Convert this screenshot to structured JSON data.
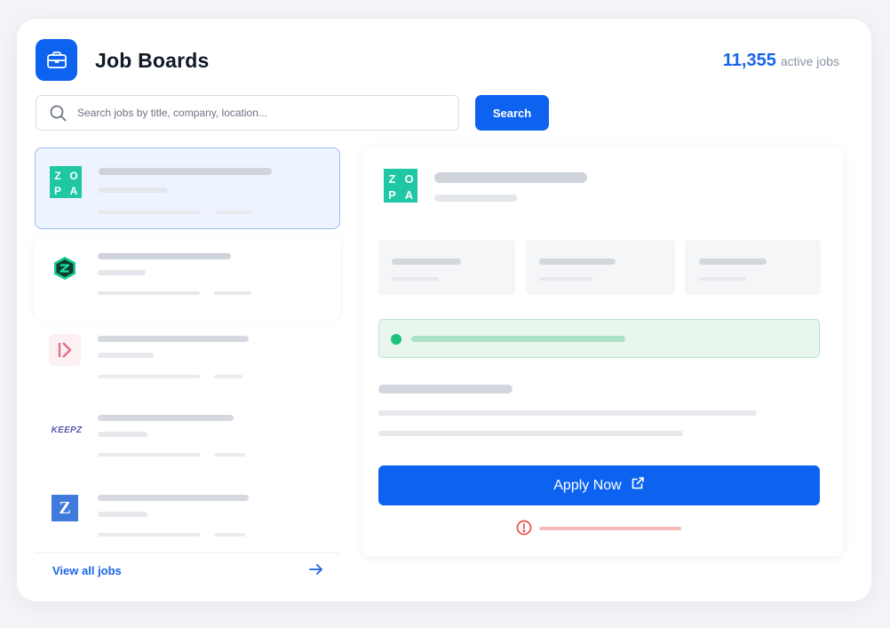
{
  "header": {
    "title": "Job Boards",
    "app_icon": "briefcase-icon",
    "active_count": "11,355",
    "active_label": "active jobs"
  },
  "search": {
    "placeholder": "Search jobs by title, company, location...",
    "button_label": "Search",
    "icon": "search-icon"
  },
  "job_list": {
    "items": [
      {
        "company_logo": "zopa-logo",
        "logo_text": [
          "Z",
          "O",
          "P",
          "A"
        ],
        "selected": true
      },
      {
        "company_logo": "hexagon-logo",
        "selected": false
      },
      {
        "company_logo": "chevron-logo",
        "selected": false
      },
      {
        "company_logo": "keepz-logo",
        "logo_text": "KEEPZ",
        "selected": false
      },
      {
        "company_logo": "z-logo",
        "logo_text": "Z",
        "selected": false
      }
    ],
    "view_all_label": "View all jobs"
  },
  "detail": {
    "company_logo": "zopa-logo",
    "logo_text": [
      "Z",
      "O",
      "P",
      "A"
    ],
    "apply_label": "Apply Now",
    "apply_icon": "external-link-icon",
    "warning_icon": "alert-circle-icon"
  },
  "colors": {
    "accent": "#0d63f0",
    "count": "#1764e8",
    "zopa": "#1fc7a4",
    "status_green": "#1ec27a",
    "warning_red": "#e84b4b"
  }
}
